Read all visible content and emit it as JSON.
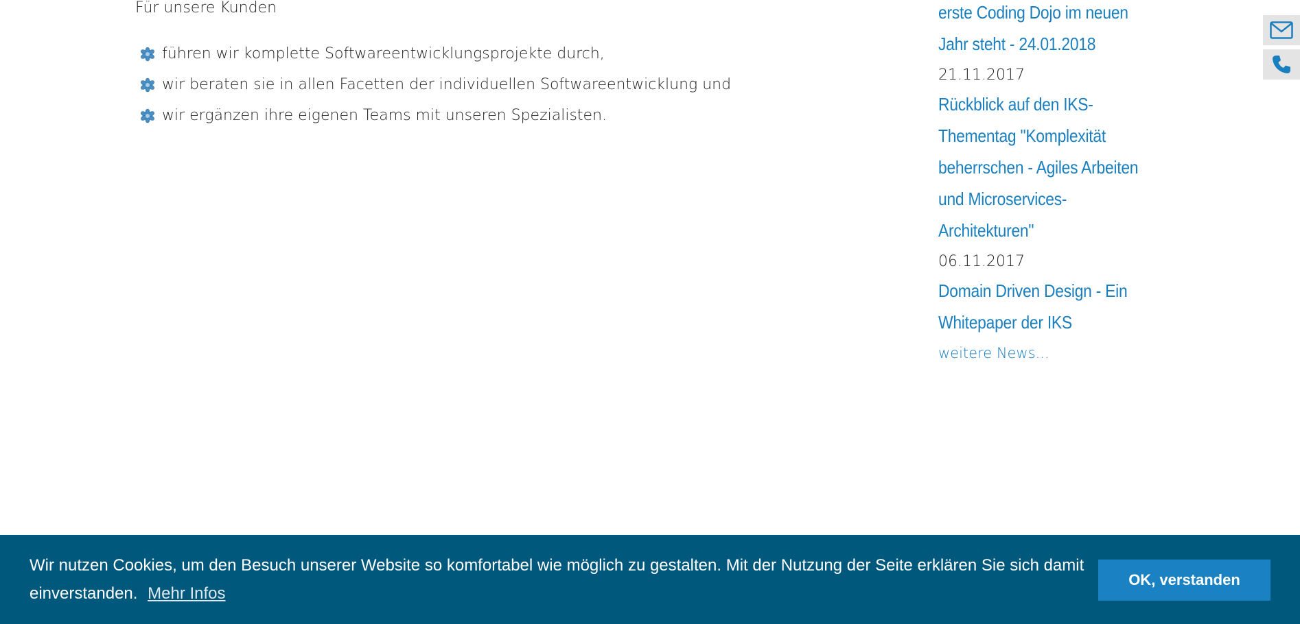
{
  "main": {
    "intro": "Für unsere Kunden",
    "bullets": [
      "führen wir komplette Softwareentwicklungsprojekte durch,",
      "wir beraten sie in allen Facetten der individuellen Softwareentwicklung und",
      "wir ergänzen ihre eigenen Teams mit unseren Spezialisten."
    ]
  },
  "news": {
    "items": [
      {
        "date": "",
        "lines": [
          "erste Coding Dojo im neuen",
          "Jahr steht - 24.01.2018"
        ]
      },
      {
        "date": "21.11.2017",
        "lines": [
          "Rückblick auf den IKS-",
          "Thementag \"Komplexität",
          "beherrschen - Agiles Arbeiten",
          "und Microservices-",
          "Architekturen\""
        ]
      },
      {
        "date": "06.11.2017",
        "lines": [
          "Domain Driven Design - Ein",
          "Whitepaper der IKS"
        ]
      }
    ],
    "more_label": "weitere News..."
  },
  "side_contact": {
    "icons": [
      "mail-icon",
      "phone-icon"
    ],
    "color": "#1a7fbf"
  },
  "cookie": {
    "text": "Wir nutzen Cookies, um den Besuch unserer Website so komfortabel wie möglich zu gestalten. Mit der Nutzung der Seite erklären Sie sich damit einverstanden.",
    "more_label": "Mehr Infos",
    "ok_label": "OK, verstanden",
    "bar_color": "#00587c",
    "button_color": "#1a82c3"
  }
}
